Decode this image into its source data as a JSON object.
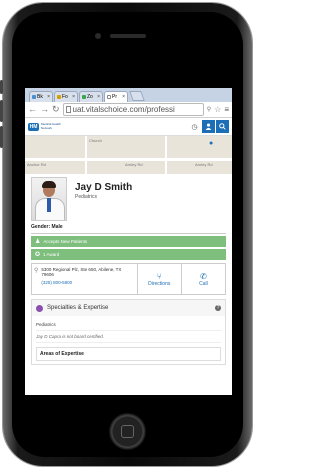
{
  "browser": {
    "tabs": [
      {
        "label": "Bk"
      },
      {
        "label": "Fo"
      },
      {
        "label": "Zo"
      },
      {
        "label": "Pr",
        "active": true
      }
    ],
    "url": "uat.vitalschoice.com/professi"
  },
  "site": {
    "logo_text": "Medical Health Network",
    "map_labels": [
      "Anchor Rd",
      "Church",
      "Arnley Rd",
      "Arnley Rd"
    ]
  },
  "profile": {
    "name": "Jay D Smith",
    "specialty": "Pediatrics",
    "gender_label": "Gender: Male"
  },
  "badges": {
    "accepts": "Accepts New Patients",
    "award": "1 Award"
  },
  "location": {
    "address": "5300 Regional Plz, Ste 650, Abilene, TX 79606",
    "phone": "(325) 800-5800",
    "directions_label": "Directions",
    "call_label": "Call"
  },
  "specialties": {
    "title": "Specialties & Expertise",
    "items": [
      "Pediatrics"
    ],
    "note": "Jay D Capra is not board certified.",
    "areas_title": "Areas of Expertise"
  },
  "colors": {
    "brand_blue": "#1c6fb7",
    "green": "#7ebf7e",
    "purple": "#8a4fb0"
  }
}
